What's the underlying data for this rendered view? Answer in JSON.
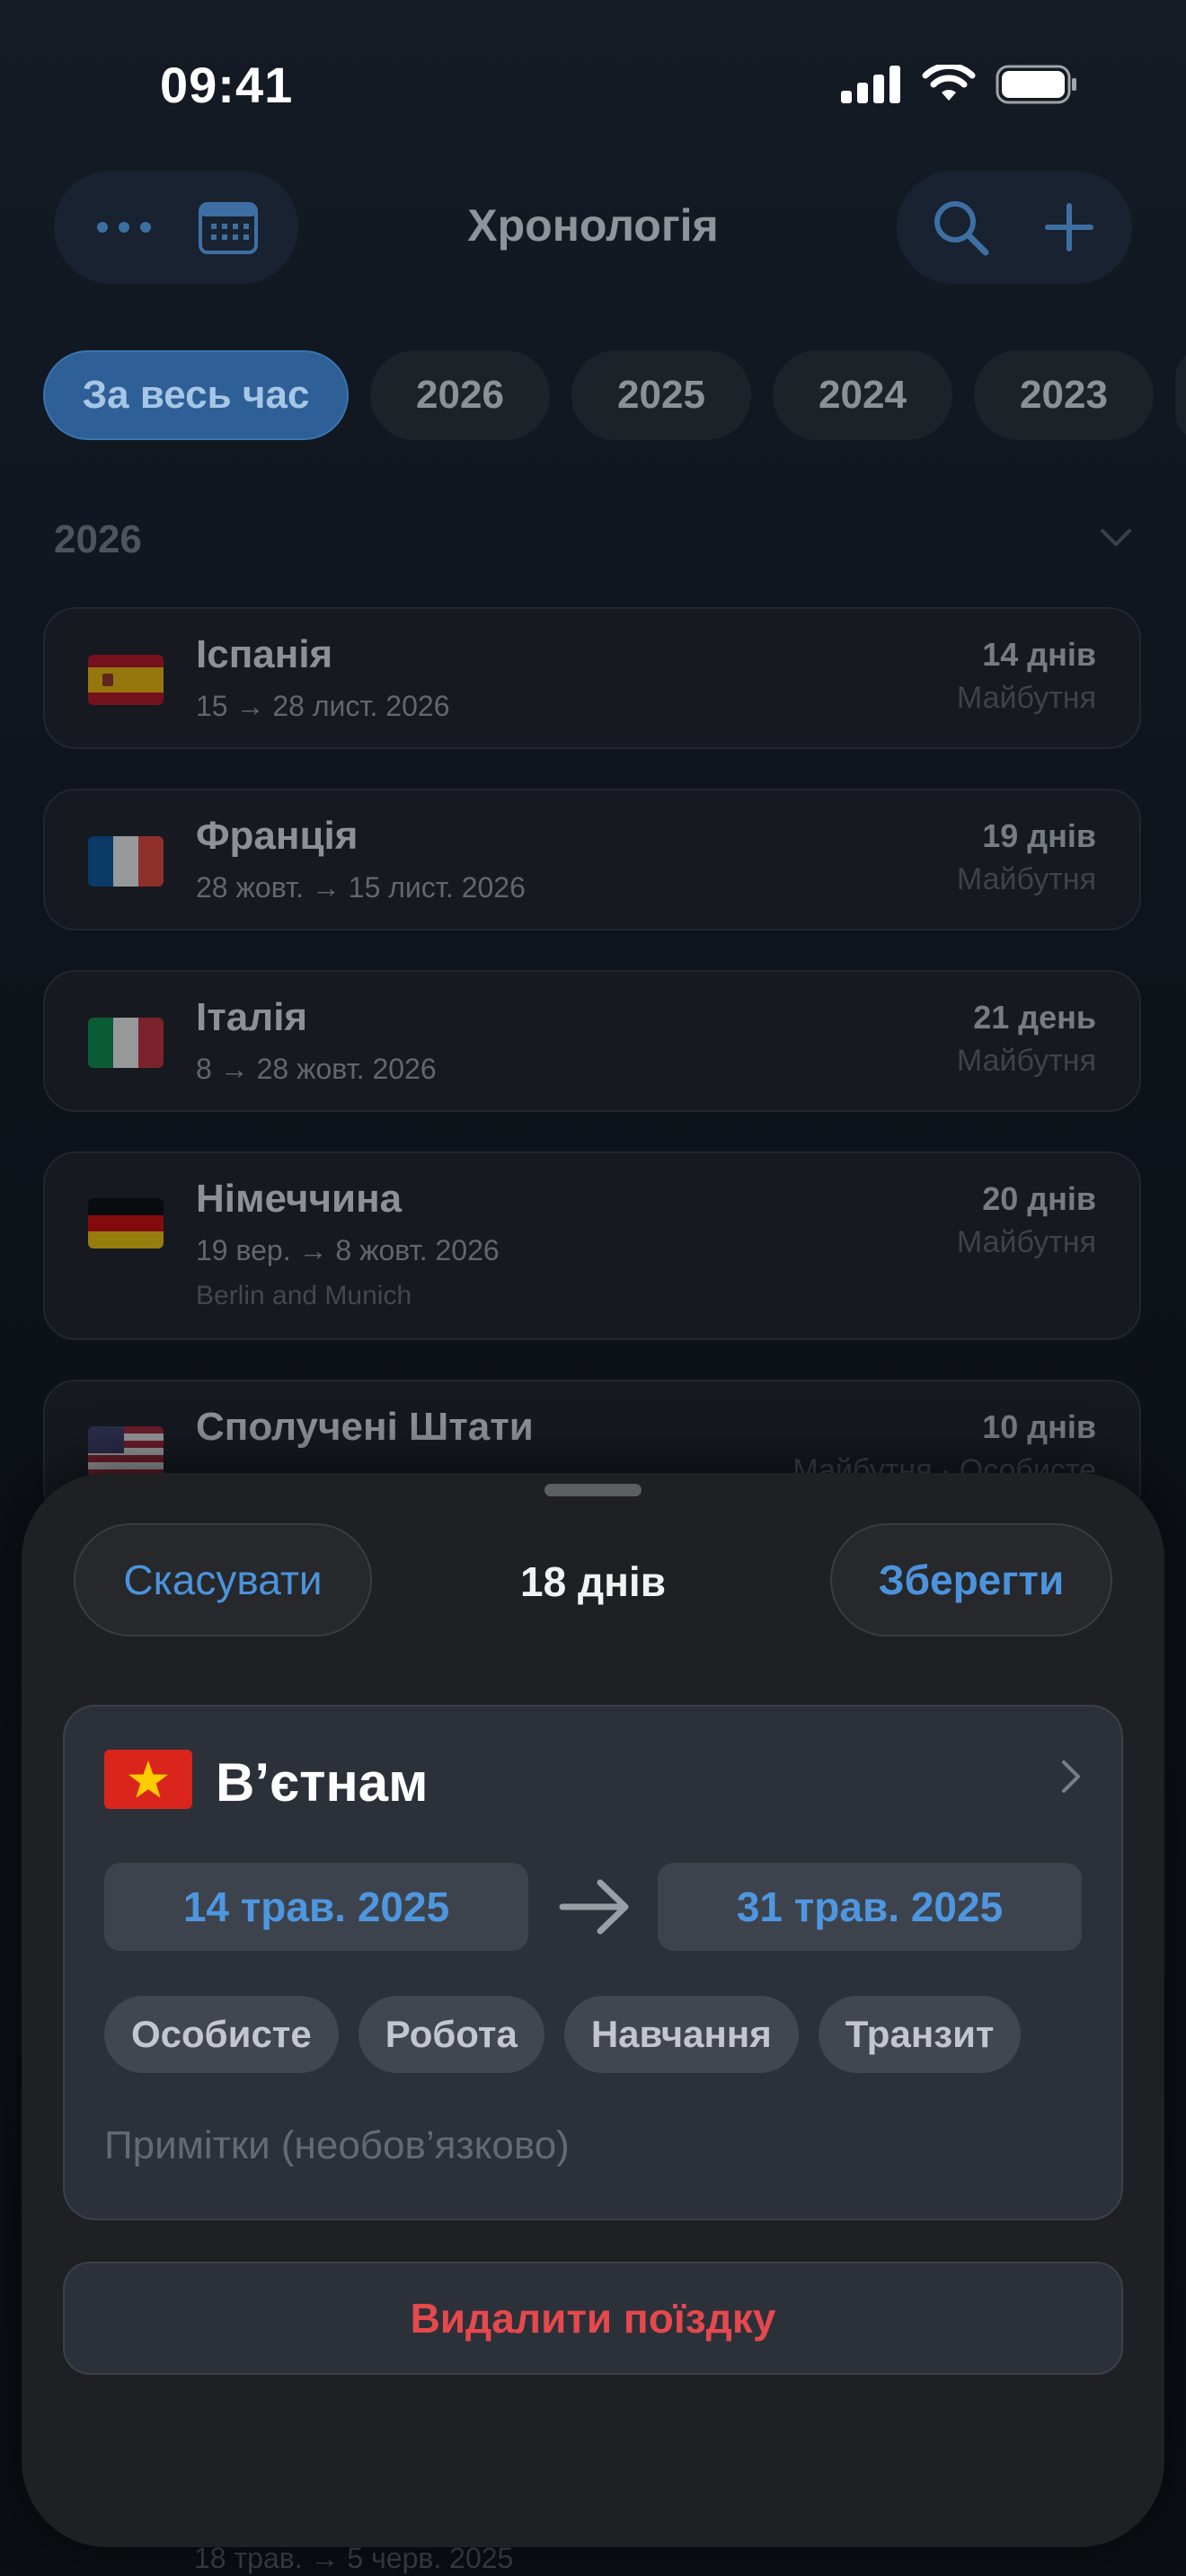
{
  "status_bar": {
    "time": "09:41"
  },
  "nav": {
    "title": "Хронологія"
  },
  "year_filters": [
    {
      "label": "За весь час",
      "active": true
    },
    {
      "label": "2026",
      "active": false
    },
    {
      "label": "2025",
      "active": false
    },
    {
      "label": "2024",
      "active": false
    },
    {
      "label": "2023",
      "active": false
    }
  ],
  "section": {
    "title": "2026"
  },
  "trips": [
    {
      "country": "Іспанія",
      "dates": "15 → 28 лист. 2026",
      "note": "",
      "days": "14 днів",
      "status": "Майбутня",
      "flag": "spain-flag-icon"
    },
    {
      "country": "Франція",
      "dates": "28 жовт. → 15 лист. 2026",
      "note": "",
      "days": "19 днів",
      "status": "Майбутня",
      "flag": "france-flag-icon"
    },
    {
      "country": "Італія",
      "dates": "8 → 28 жовт. 2026",
      "note": "",
      "days": "21 день",
      "status": "Майбутня",
      "flag": "italy-flag-icon"
    },
    {
      "country": "Німеччина",
      "dates": "19 вер. → 8 жовт. 2026",
      "note": "Berlin and Munich",
      "days": "20 днів",
      "status": "Майбутня",
      "flag": "germany-flag-icon"
    },
    {
      "country": "Сполучені Штати",
      "dates": "",
      "note": "",
      "days": "10 днів",
      "status": "Майбутня · Особисте",
      "flag": "usa-flag-icon"
    }
  ],
  "bottom_peek": "18 трав. → 5 черв. 2025",
  "sheet": {
    "cancel_label": "Скасувати",
    "title": "18 днів",
    "save_label": "Зберегти",
    "country": "В’єтнам",
    "start_date": "14 трав. 2025",
    "end_date": "31 трав. 2025",
    "tags": [
      "Особисте",
      "Робота",
      "Навчання",
      "Транзит"
    ],
    "notes_placeholder": "Примітки (необов’язково)",
    "delete_label": "Видалити поїздку"
  },
  "colors": {
    "accent": "#4c93dc",
    "destructive": "#e5484d",
    "sheet_bg": "#1e2024",
    "active_chip": "#2e5f96"
  }
}
